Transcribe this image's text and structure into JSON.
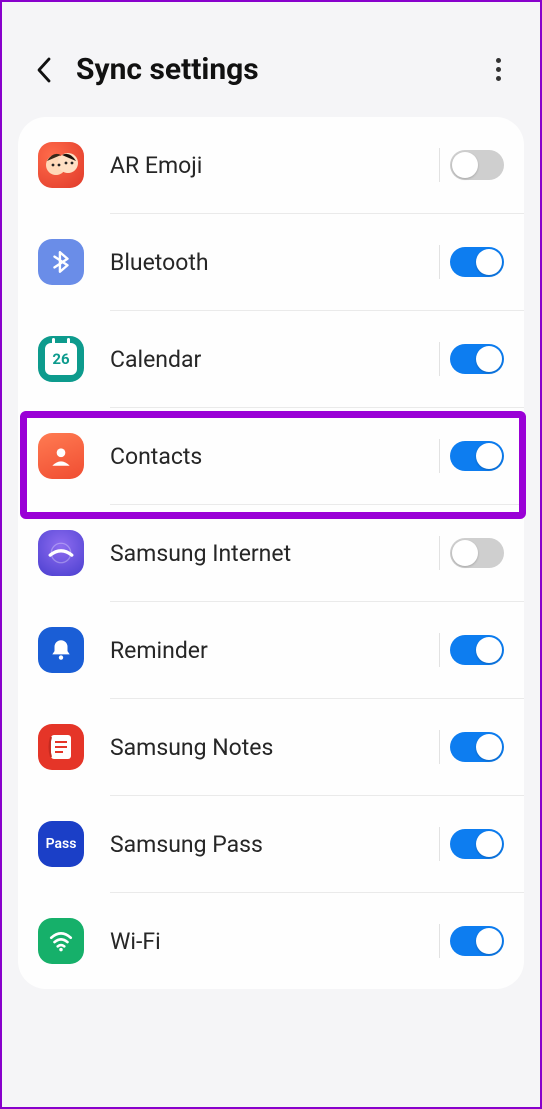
{
  "header": {
    "title": "Sync settings"
  },
  "items": [
    {
      "id": "ar-emoji",
      "label": "AR Emoji",
      "enabled": false,
      "highlighted": false,
      "calNum": ""
    },
    {
      "id": "bluetooth",
      "label": "Bluetooth",
      "enabled": true,
      "highlighted": false,
      "calNum": ""
    },
    {
      "id": "calendar",
      "label": "Calendar",
      "enabled": true,
      "highlighted": false,
      "calNum": "26"
    },
    {
      "id": "contacts",
      "label": "Contacts",
      "enabled": true,
      "highlighted": true,
      "calNum": ""
    },
    {
      "id": "samsung-internet",
      "label": "Samsung Internet",
      "enabled": false,
      "highlighted": false,
      "calNum": ""
    },
    {
      "id": "reminder",
      "label": "Reminder",
      "enabled": true,
      "highlighted": false,
      "calNum": ""
    },
    {
      "id": "samsung-notes",
      "label": "Samsung Notes",
      "enabled": true,
      "highlighted": false,
      "calNum": ""
    },
    {
      "id": "samsung-pass",
      "label": "Samsung Pass",
      "enabled": true,
      "highlighted": false,
      "calNum": ""
    },
    {
      "id": "wifi",
      "label": "Wi-Fi",
      "enabled": true,
      "highlighted": false,
      "calNum": ""
    }
  ]
}
